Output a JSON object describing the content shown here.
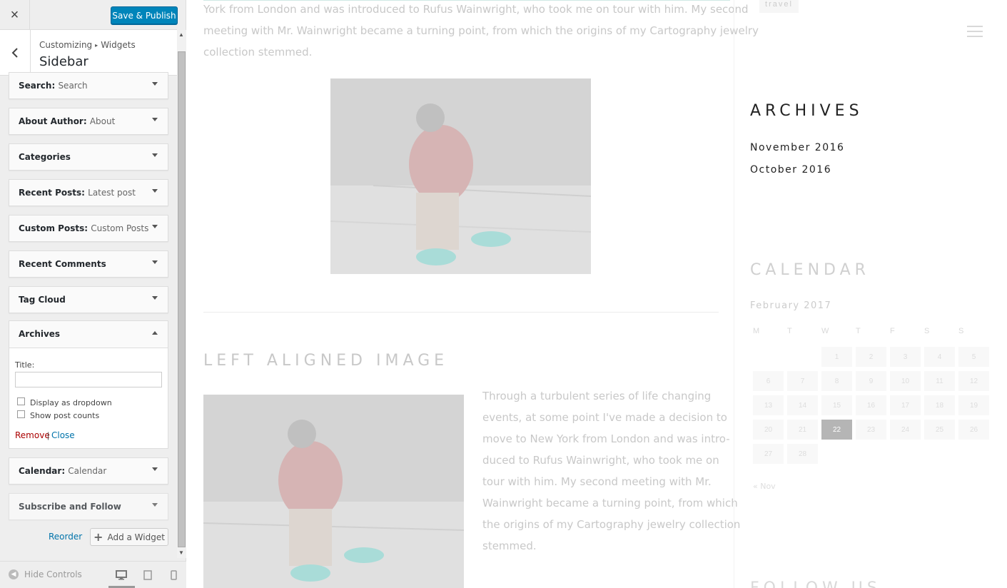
{
  "customizer": {
    "close_icon": "×",
    "save_label": "Save & Publish",
    "breadcrumb_root": "Customizing",
    "breadcrumb_sep": "▸",
    "breadcrumb_section": "Widgets",
    "section_title": "Sidebar"
  },
  "widgets": [
    {
      "title": "Search",
      "sub": "Search"
    },
    {
      "title": "About Author",
      "sub": "About"
    },
    {
      "title": "Categories",
      "sub": ""
    },
    {
      "title": "Recent Posts",
      "sub": "Latest post"
    },
    {
      "title": "Custom Posts",
      "sub": "Custom Posts"
    },
    {
      "title": "Recent Comments",
      "sub": ""
    },
    {
      "title": "Tag Cloud",
      "sub": ""
    },
    {
      "title": "Archives",
      "sub": ""
    },
    {
      "title": "Calendar",
      "sub": "Calendar"
    },
    {
      "title": "Subscribe and Follow",
      "sub": ""
    }
  ],
  "archives_form": {
    "title_label": "Title:",
    "title_value": "",
    "dropdown_label": "Display as dropdown",
    "counts_label": "Show post counts",
    "remove_label": "Remove",
    "close_label": "Close"
  },
  "actions": {
    "reorder_label": "Reorder",
    "add_widget_label": "Add a Widget"
  },
  "footer": {
    "hide_controls_label": "Hide Controls"
  },
  "preview": {
    "intro_lines": [
      "York from London and was introduced to Rufus Wainwright, who took me on tour with him. My second",
      "meeting with Mr. Wainwright became a turning point, from which the origins of my Cartography jewelry",
      "collection stemmed."
    ],
    "left_aligned_heading": "LEFT ALIGNED IMAGE",
    "body_lines": [
      "Through a turbulent series of life changing",
      "events, at some point I've made a decision to",
      "move to New York from London and was intro-",
      "duced to Rufus Wainwright, who took me on",
      "tour with him. My second meeting with Mr.",
      "Wainwright became a turning point, from which",
      "the origins of my Cartography jewelry collection",
      "stemmed."
    ],
    "tag": "travel",
    "archives_heading": "ARCHIVES",
    "archive_links": [
      "November 2016",
      "October 2016"
    ],
    "calendar_heading": "CALENDAR",
    "calendar_month": "February 2017",
    "calendar_days": [
      "M",
      "T",
      "W",
      "T",
      "F",
      "S",
      "S"
    ],
    "calendar_today": "22",
    "calendar_prev": "« Nov",
    "follow_heading": "FOLLOW US"
  },
  "colors": {
    "primary_button": "#0085ba",
    "link": "#0073aa",
    "remove": "#a00"
  }
}
